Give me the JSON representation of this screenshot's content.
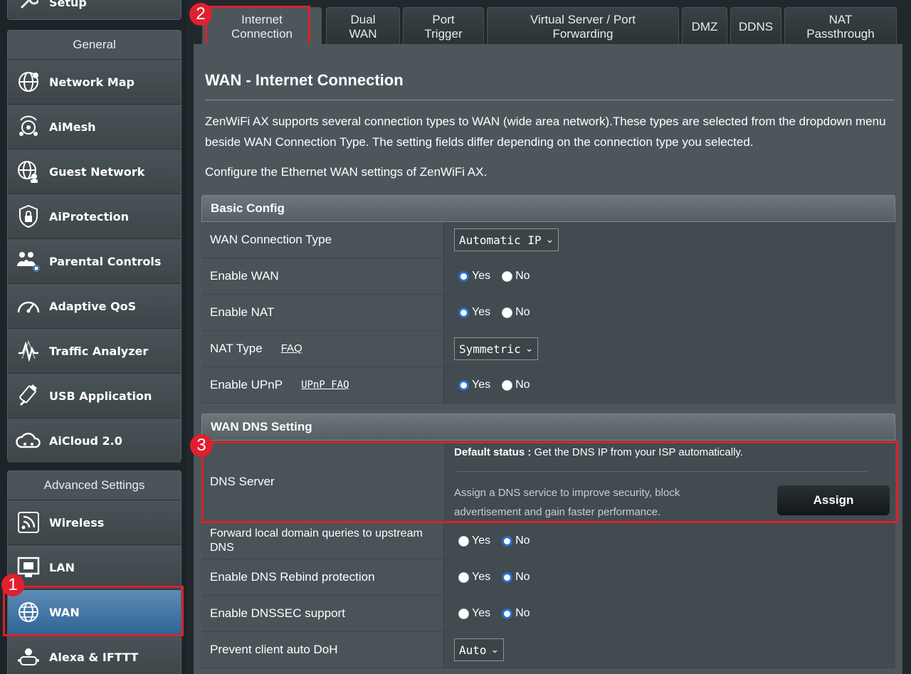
{
  "sidebar": {
    "top_item": "Setup",
    "general_header": "General",
    "general_items": [
      {
        "label": "Network Map",
        "icon": "globe-network-icon"
      },
      {
        "label": "AiMesh",
        "icon": "aimesh-icon"
      },
      {
        "label": "Guest Network",
        "icon": "guest-network-icon"
      },
      {
        "label": "AiProtection",
        "icon": "shield-lock-icon"
      },
      {
        "label": "Parental Controls",
        "icon": "family-icon"
      },
      {
        "label": "Adaptive QoS",
        "icon": "gauge-icon"
      },
      {
        "label": "Traffic Analyzer",
        "icon": "pulse-chart-icon"
      },
      {
        "label": "USB Application",
        "icon": "usb-icon"
      },
      {
        "label": "AiCloud 2.0",
        "icon": "cloud-icon"
      }
    ],
    "advanced_header": "Advanced Settings",
    "advanced_items": [
      {
        "label": "Wireless",
        "icon": "wifi-icon"
      },
      {
        "label": "LAN",
        "icon": "lan-icon"
      },
      {
        "label": "WAN",
        "icon": "globe-icon",
        "active": true
      },
      {
        "label": "Alexa & IFTTT",
        "icon": "alexa-icon"
      }
    ]
  },
  "tabs": [
    {
      "label": "Internet Connection",
      "active": true
    },
    {
      "label": "Dual WAN"
    },
    {
      "label": "Port Trigger"
    },
    {
      "label": "Virtual Server / Port Forwarding"
    },
    {
      "label": "DMZ"
    },
    {
      "label": "DDNS"
    },
    {
      "label": "NAT Passthrough"
    }
  ],
  "page": {
    "title": "WAN - Internet Connection",
    "description": "ZenWiFi AX supports several connection types to WAN (wide area network).These types are selected from the dropdown menu beside WAN Connection Type. The setting fields differ depending on the connection type you selected.",
    "description2": "Configure the Ethernet WAN settings of ZenWiFi AX."
  },
  "basic_config": {
    "header": "Basic Config",
    "wan_connection_type": {
      "label": "WAN Connection Type",
      "value": "Automatic IP"
    },
    "enable_wan": {
      "label": "Enable WAN",
      "yes": "Yes",
      "no": "No",
      "selected": "Yes"
    },
    "enable_nat": {
      "label": "Enable NAT",
      "yes": "Yes",
      "no": "No",
      "selected": "Yes"
    },
    "nat_type": {
      "label": "NAT Type",
      "link": "FAQ",
      "value": "Symmetric"
    },
    "enable_upnp": {
      "label": "Enable UPnP",
      "link": "UPnP FAQ",
      "yes": "Yes",
      "no": "No",
      "selected": "Yes"
    }
  },
  "dns_setting": {
    "header": "WAN DNS Setting",
    "dns_server": {
      "label": "DNS Server",
      "status_label": "Default status :",
      "status_text": " Get the DNS IP from your ISP automatically.",
      "assign_text_1": "Assign a DNS service to improve security, block",
      "assign_text_2": "advertisement and gain faster performance.",
      "assign_button": "Assign"
    },
    "forward_local": {
      "label_1": "Forward local domain queries to upstream",
      "label_2": "DNS",
      "yes": "Yes",
      "no": "No",
      "selected": "No"
    },
    "rebind": {
      "label": "Enable DNS Rebind protection",
      "yes": "Yes",
      "no": "No",
      "selected": "No"
    },
    "dnssec": {
      "label": "Enable DNSSEC support",
      "yes": "Yes",
      "no": "No",
      "selected": "No"
    },
    "doh": {
      "label": "Prevent client auto DoH",
      "value": "Auto"
    }
  },
  "annotations": {
    "one": "1",
    "two": "2",
    "three": "3"
  },
  "colors": {
    "highlight": "#d8222e",
    "active_nav": "#2e6496",
    "radio_on": "#1e6ad0"
  }
}
